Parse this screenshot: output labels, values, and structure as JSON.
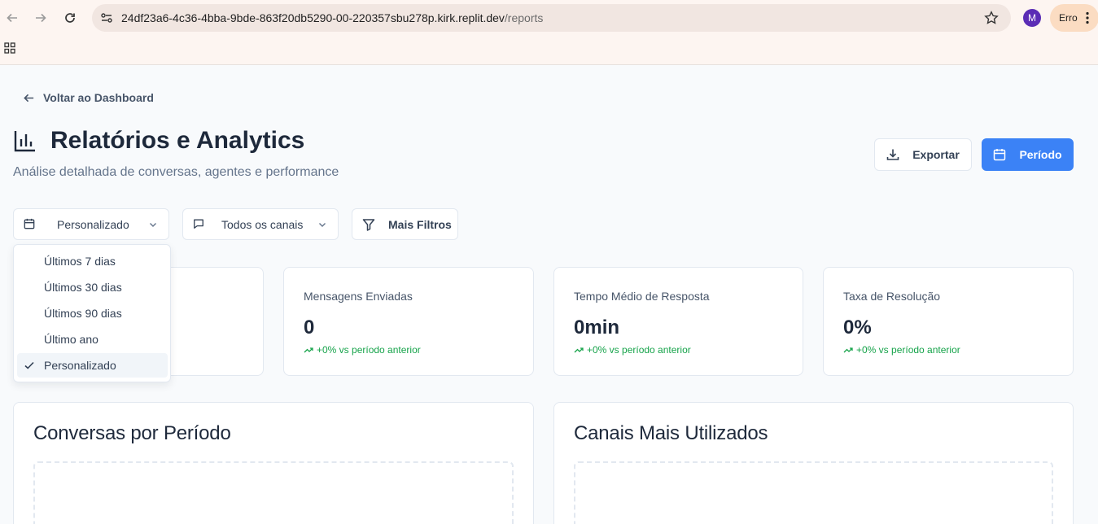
{
  "browser": {
    "url_host": "24df23a6-4c36-4bba-9bde-863f20db5290-00-220357sbu278p.kirk.replit.dev",
    "url_path": "/reports",
    "avatar_letter": "M",
    "error_label": "Erro"
  },
  "page": {
    "back_link": "Voltar ao Dashboard",
    "title": "Relatórios e Analytics",
    "subtitle": "Análise detalhada de conversas, agentes e performance",
    "export_button": "Exportar",
    "period_button": "Período"
  },
  "filters": {
    "date_range": "Personalizado",
    "channels": "Todos os canais",
    "more_filters": "Mais Filtros"
  },
  "date_menu": {
    "options": [
      "Últimos 7 dias",
      "Últimos 30 dias",
      "Últimos 90 dias",
      "Último ano",
      "Personalizado"
    ],
    "selected": "Personalizado"
  },
  "stats": [
    {
      "label": "Mensagens Enviadas",
      "value": "0",
      "trend": "+0% vs período anterior"
    },
    {
      "label": "Tempo Médio de Resposta",
      "value": "0min",
      "trend": "+0% vs período anterior"
    },
    {
      "label": "Taxa de Resolução",
      "value": "0%",
      "trend": "+0% vs período anterior"
    }
  ],
  "charts": {
    "left_title": "Conversas por Período",
    "right_title": "Canais Mais Utilizados"
  },
  "colors": {
    "primary": "#3b82f6",
    "trend_positive": "#16a34a",
    "text_dark": "#1e293b",
    "text_muted": "#64748b"
  }
}
